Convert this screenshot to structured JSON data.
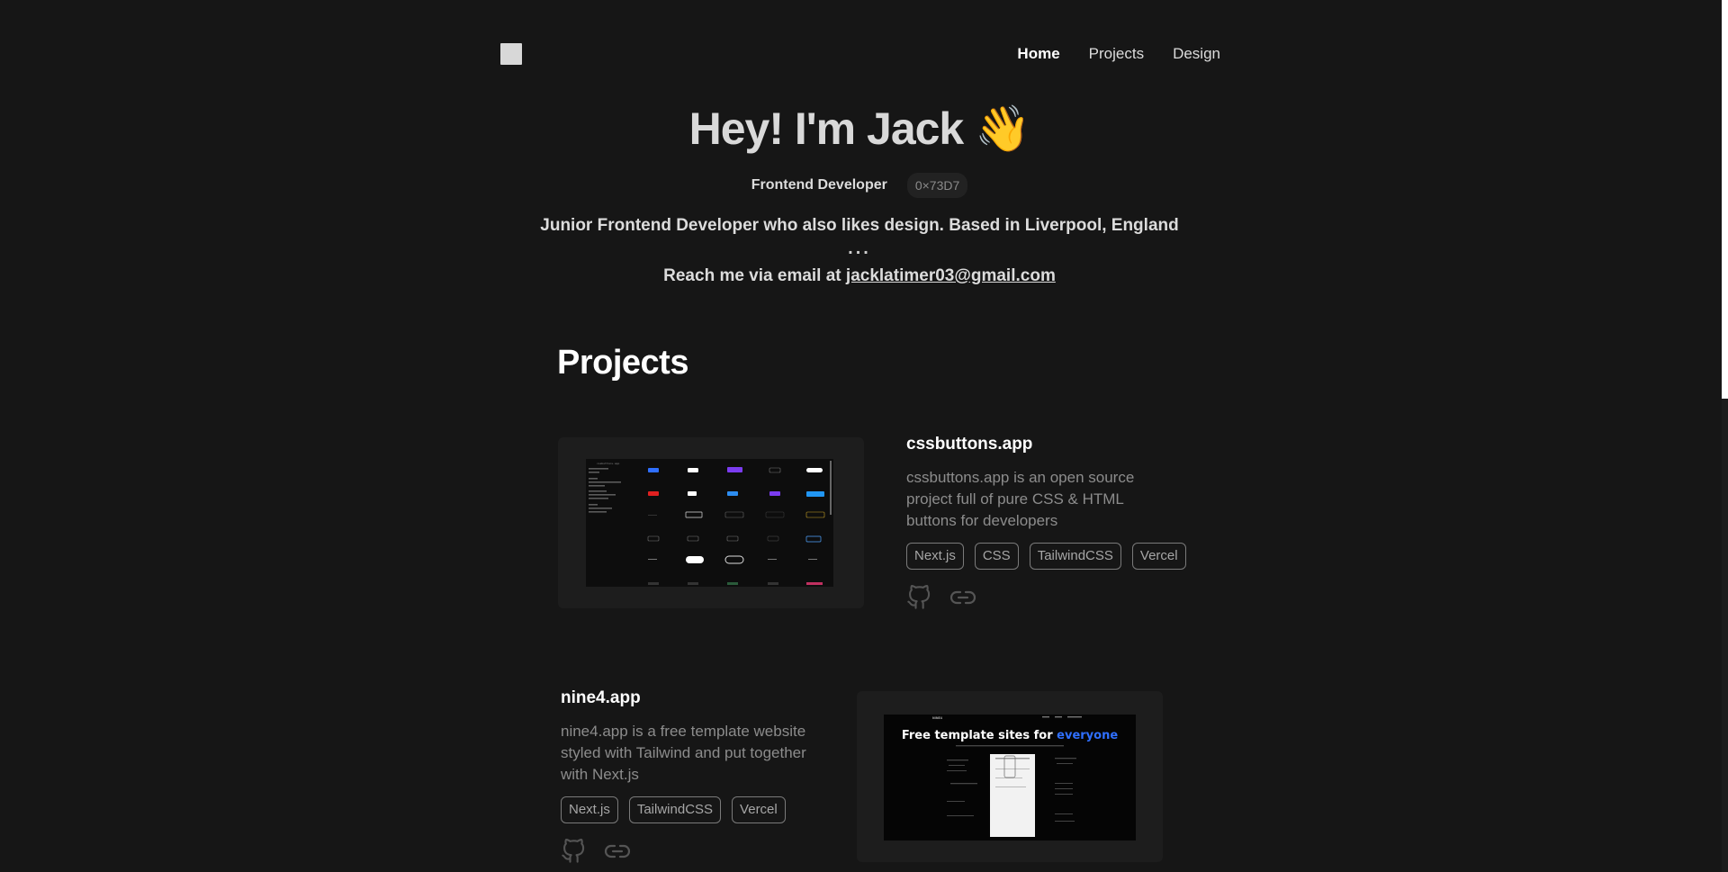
{
  "header": {
    "nav": [
      {
        "label": "Home",
        "active": true
      },
      {
        "label": "Projects",
        "active": false
      },
      {
        "label": "Design",
        "active": false
      }
    ]
  },
  "hero": {
    "title": "Hey! I'm Jack 👋",
    "role": "Frontend Developer",
    "hex": "0×73D7",
    "bio": "Junior Frontend Developer who also likes design. Based in Liverpool, England",
    "dots": "...",
    "contact_prefix": "Reach me via email at ",
    "email": "jacklatimer03@gmail.com"
  },
  "projects": {
    "heading": "Projects",
    "items": [
      {
        "name": "cssbuttons.app",
        "description": "cssbuttons.app is an open source project full of pure CSS & HTML buttons for developers",
        "tags": [
          "Next.js",
          "CSS",
          "TailwindCSS",
          "Vercel"
        ],
        "screenshot": {
          "title": "cssbuttons.app"
        }
      },
      {
        "name": "nine4.app",
        "description": "nine4.app is a free template website styled with Tailwind and put together with Next.js",
        "tags": [
          "Next.js",
          "TailwindCSS",
          "Vercel"
        ],
        "screenshot": {
          "brand": "NINE4",
          "headline": "Free template sites for ",
          "headline_accent": "everyone"
        }
      }
    ]
  },
  "colors": {
    "background": "#161616",
    "text": "#dcdcdc",
    "muted": "#8c8c8c",
    "accent_blue": "#2f6fff"
  },
  "icons": [
    "github-icon",
    "link-icon"
  ]
}
